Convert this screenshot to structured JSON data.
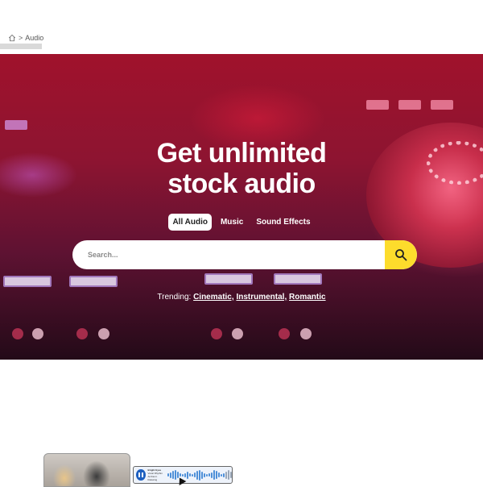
{
  "breadcrumb": {
    "home_icon": "home-icon",
    "separator": ">",
    "current": "Audio"
  },
  "hero": {
    "title_line1": "Get unlimited",
    "title_line2": "stock audio",
    "tabs": [
      {
        "label": "All Audio",
        "active": true
      },
      {
        "label": "Music",
        "active": false
      },
      {
        "label": "Sound Effects",
        "active": false
      }
    ],
    "search": {
      "placeholder": "Search...",
      "value": "",
      "button_icon": "search-icon",
      "button_color": "#FDDC2C"
    },
    "trending": {
      "label": "Trending:",
      "items": [
        "Cinematic,",
        "Instrumental,",
        "Romantic"
      ]
    }
  },
  "preview": {
    "thumbnail": "people-photo-thumbnail",
    "player": {
      "icon": "pause-icon",
      "track_title": "Bright Eyes",
      "track_meta_1": "Vocal Rhythm",
      "track_meta_2": "Ambient · Relaxing",
      "accent_color": "#1D5FBF"
    }
  }
}
